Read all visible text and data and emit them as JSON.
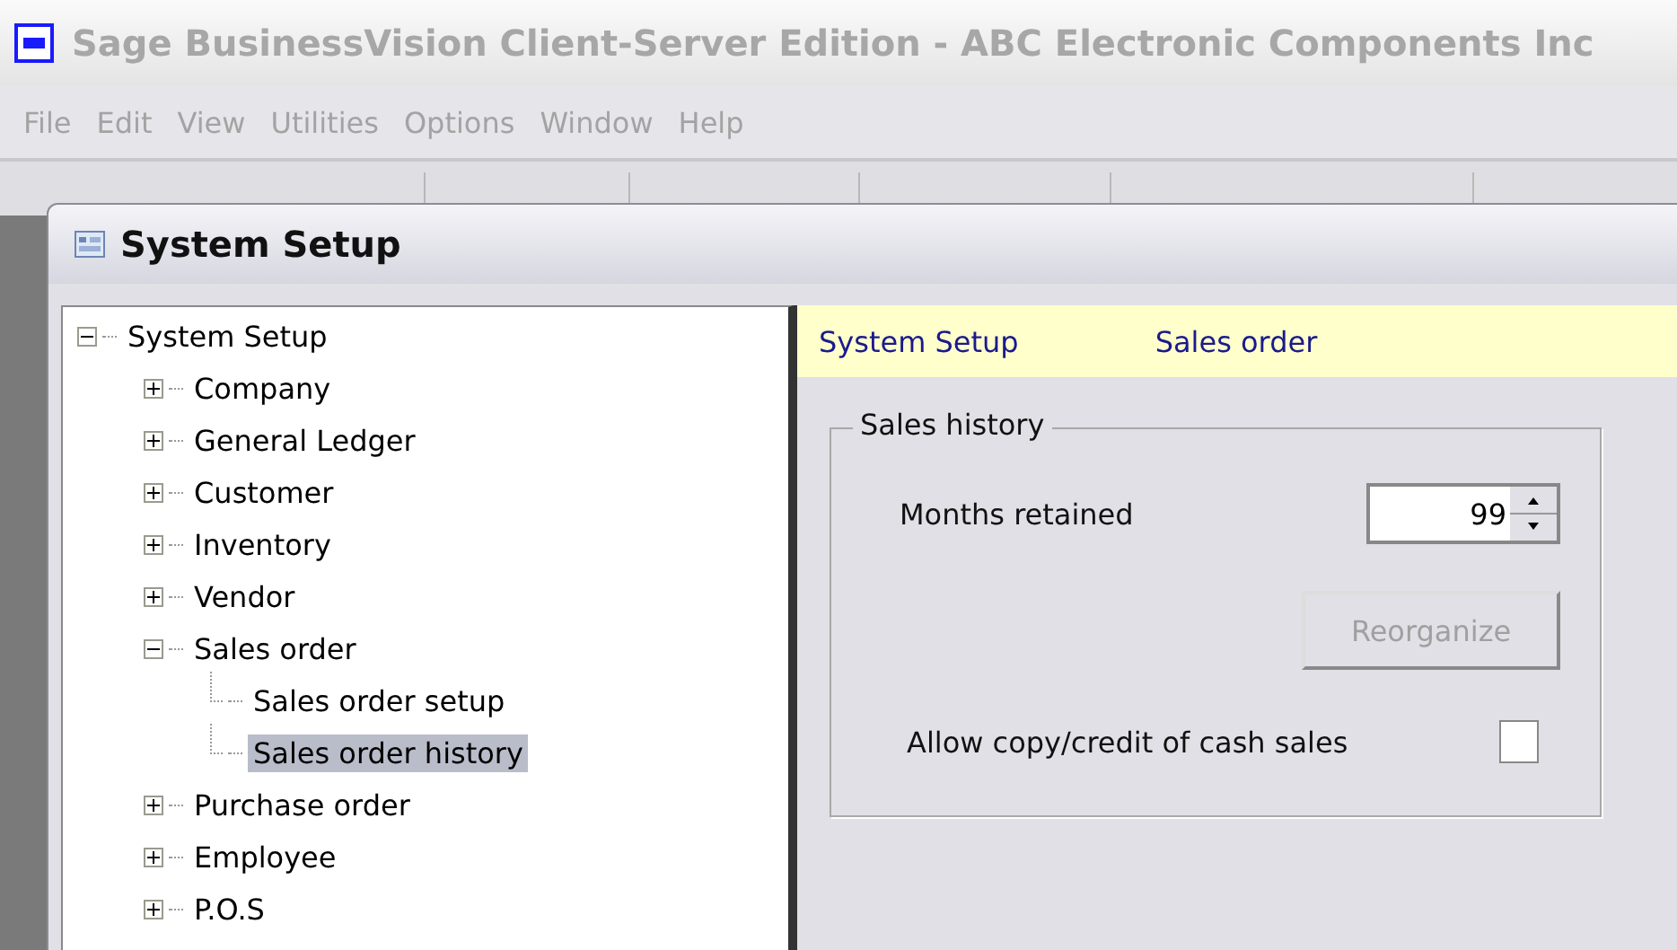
{
  "window": {
    "title": "Sage BusinessVision Client-Server Edition - ABC Electronic Components Inc"
  },
  "menu": [
    "File",
    "Edit",
    "View",
    "Utilities",
    "Options",
    "Window",
    "Help"
  ],
  "dialog": {
    "title": "System Setup"
  },
  "tree": [
    {
      "label": "System Setup",
      "expanded": true,
      "selected": false,
      "children": [
        {
          "label": "Company",
          "expanded": false,
          "selected": false
        },
        {
          "label": "General Ledger",
          "expanded": false,
          "selected": false
        },
        {
          "label": "Customer",
          "expanded": false,
          "selected": false
        },
        {
          "label": "Inventory",
          "expanded": false,
          "selected": false
        },
        {
          "label": "Vendor",
          "expanded": false,
          "selected": false
        },
        {
          "label": "Sales order",
          "expanded": true,
          "selected": false,
          "children": [
            {
              "label": "Sales order setup",
              "selected": false
            },
            {
              "label": "Sales order history",
              "selected": true
            }
          ]
        },
        {
          "label": "Purchase order",
          "expanded": false,
          "selected": false
        },
        {
          "label": "Employee",
          "expanded": false,
          "selected": false
        },
        {
          "label": "P.O.S",
          "expanded": false,
          "selected": false
        }
      ]
    }
  ],
  "breadcrumb": [
    "System Setup",
    "Sales order"
  ],
  "group": {
    "title": "Sales history",
    "months_label": "Months retained",
    "months_value": "99",
    "reorganize": {
      "label": "Reorganize",
      "disabled": true
    },
    "allow_copy": {
      "label": "Allow copy/credit of cash sales",
      "checked": false
    }
  }
}
